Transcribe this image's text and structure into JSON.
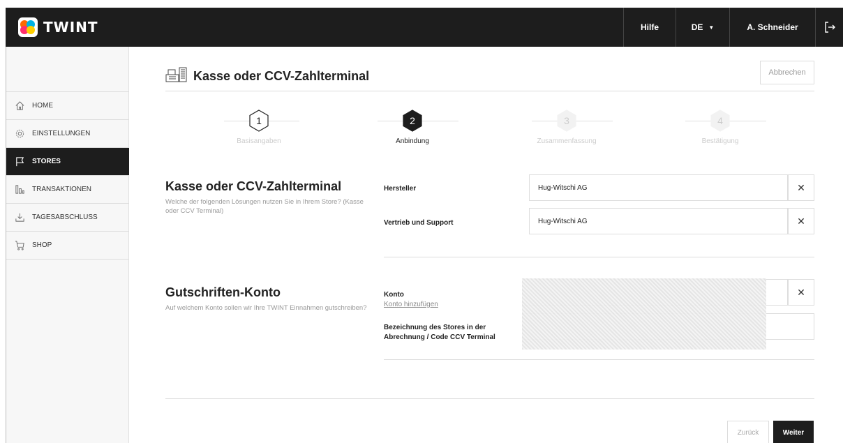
{
  "header": {
    "brand": "TWINT",
    "help": "Hilfe",
    "language": "DE",
    "user": "A. Schneider"
  },
  "sidebar": {
    "items": [
      {
        "label": "HOME",
        "icon": "home-icon"
      },
      {
        "label": "EINSTELLUNGEN",
        "icon": "gear-icon"
      },
      {
        "label": "STORES",
        "icon": "flag-icon",
        "active": true
      },
      {
        "label": "TRANSAKTIONEN",
        "icon": "bar-chart-icon"
      },
      {
        "label": "TAGESABSCHLUSS",
        "icon": "download-icon"
      },
      {
        "label": "SHOP",
        "icon": "cart-icon"
      }
    ]
  },
  "page": {
    "title": "Kasse oder CCV-Zahlterminal",
    "cancel": "Abbrechen"
  },
  "stepper": {
    "steps": [
      {
        "num": "1",
        "label": "Basisangaben",
        "state": "done"
      },
      {
        "num": "2",
        "label": "Anbindung",
        "state": "active"
      },
      {
        "num": "3",
        "label": "Zusammenfassung",
        "state": "future"
      },
      {
        "num": "4",
        "label": "Bestätigung",
        "state": "future"
      }
    ]
  },
  "section_terminal": {
    "title": "Kasse oder CCV-Zahlterminal",
    "description": "Welche der folgenden Lösungen nutzen Sie in Ihrem Store? (Kasse oder CCV Terminal)",
    "manufacturer_label": "Hersteller",
    "manufacturer_value": "Hug-Witschi AG",
    "support_label": "Vertrieb und Support",
    "support_value": "Hug-Witschi AG"
  },
  "section_account": {
    "title": "Gutschriften-Konto",
    "description": "Auf welchem Konto sollen wir Ihre TWINT Einnahmen gutschreiben?",
    "account_label": "Konto",
    "add_account_link": "Konto hinzufügen",
    "store_label": "Bezeichnung des Stores in der Abrechnung / Code CCV Terminal"
  },
  "footer": {
    "back": "Zurück",
    "next": "Weiter"
  },
  "colors": {
    "dark": "#1d1d1d",
    "border": "#dddddd",
    "muted": "#999999"
  }
}
